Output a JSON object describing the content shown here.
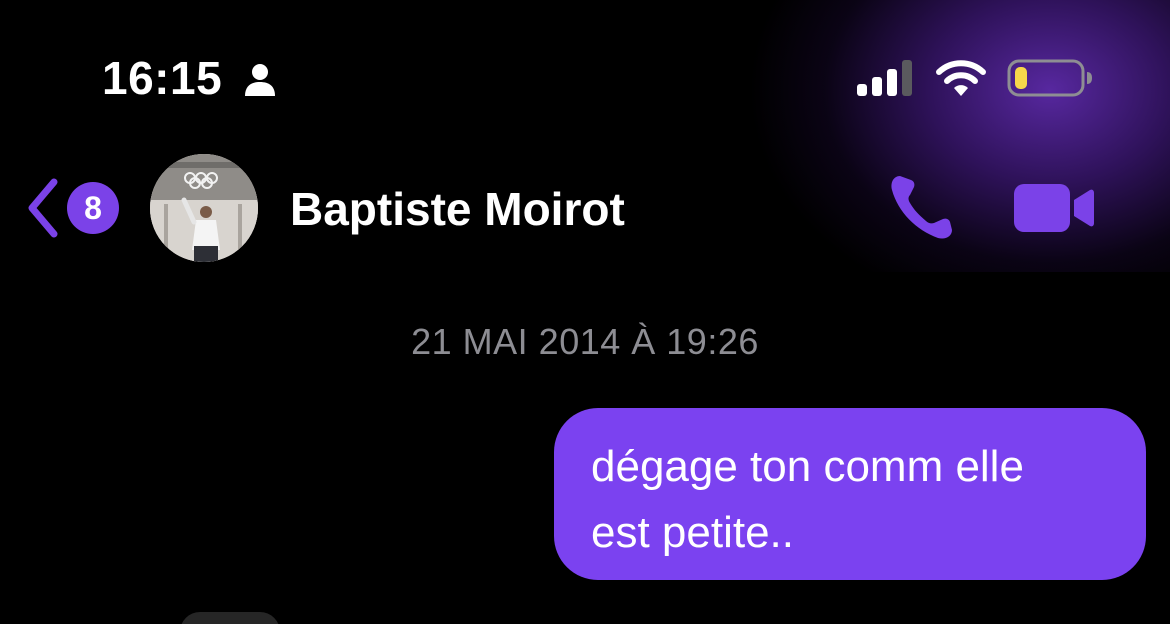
{
  "status_bar": {
    "time": "16:15",
    "icons": [
      "person-icon",
      "signal-icon",
      "wifi-icon",
      "battery-icon"
    ],
    "battery_level": 0.2,
    "battery_color": "#f7d74a"
  },
  "header": {
    "unread_count": "8",
    "contact_name": "Baptiste Moirot",
    "accent_color": "#7b42e8",
    "actions": [
      "phone-icon",
      "video-camera-icon"
    ]
  },
  "conversation": {
    "timestamp": "21 MAI 2014 À 19:26",
    "messages": [
      {
        "sender": "me",
        "lines": [
          "dégage ton comm elle",
          "est petite.."
        ],
        "bubble_color": "#7b42f0"
      }
    ]
  }
}
